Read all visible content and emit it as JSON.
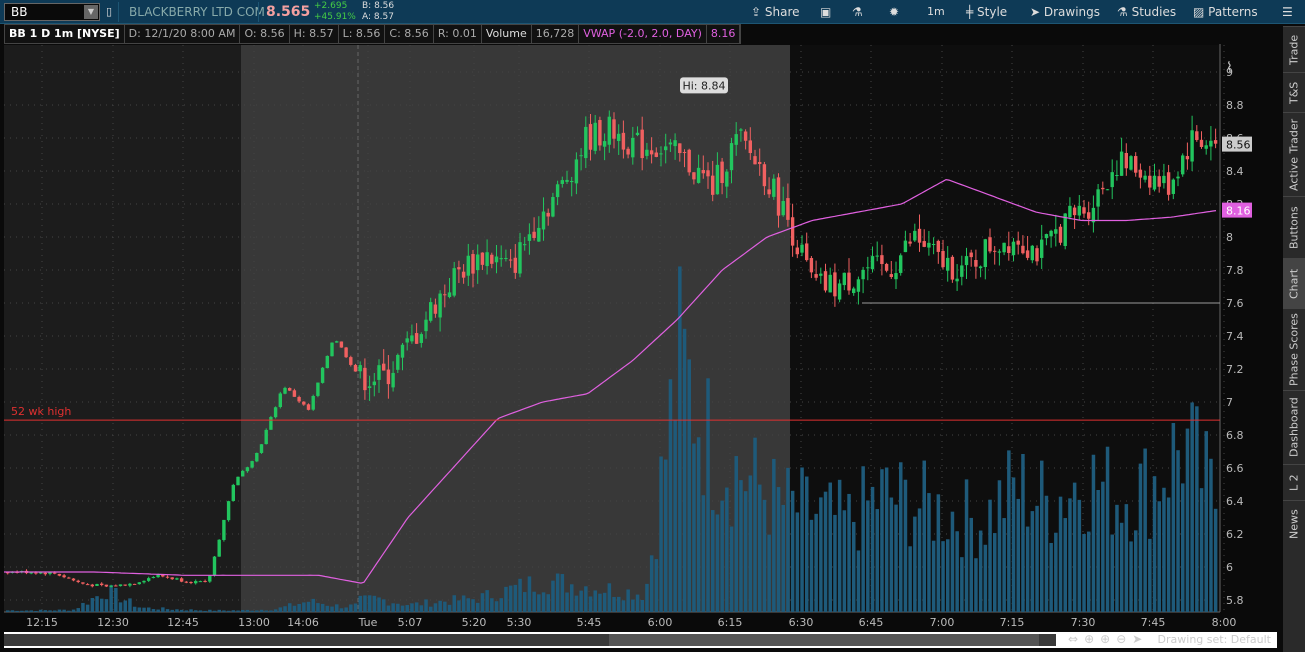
{
  "header": {
    "symbol": "BB",
    "company": "BLACKBERRY LTD COM",
    "last": "8.565",
    "change": "+2.695",
    "change_pct": "+45.91%",
    "bid": "B: 8.56",
    "ask": "A: 8.57",
    "buttons": {
      "share": "Share",
      "timeframe": "1m",
      "style": "Style",
      "drawings": "Drawings",
      "studies": "Studies",
      "patterns": "Patterns"
    }
  },
  "info_bar": [
    "BB 1 D 1m [NYSE]",
    "D: 12/1/20 8:00 AM",
    "O: 8.56",
    "H: 8.57",
    "L: 8.56",
    "C: 8.56",
    "R: 0.01",
    "Volume",
    "16,728",
    "VWAP (-2.0, 2.0, DAY)",
    "8.16"
  ],
  "side_tabs": [
    "Trade",
    "T&S",
    "Active Trader",
    "Buttons",
    "Chart",
    "Phase Scores",
    "Dashboard",
    "L 2",
    "News"
  ],
  "bottom": {
    "drawing_set": "Drawing set: Default"
  },
  "colors": {
    "up": "#22c55e",
    "down": "#f06060",
    "vwap": "#e060e0",
    "volume": "#1e5a7a",
    "wkhigh": "#e03030"
  },
  "chart_data": {
    "type": "candlestick",
    "ylim": [
      5.7,
      9.1
    ],
    "y_ticks": [
      "9",
      "8.8",
      "8.6",
      "8.4",
      "8.2",
      "8",
      "7.8",
      "7.6",
      "7.4",
      "7.2",
      "7",
      "6.8",
      "6.6",
      "6.4",
      "6.2",
      "6",
      "5.8"
    ],
    "x_labels": [
      "12:15",
      "12:30",
      "12:45",
      "13:00",
      "14:06",
      "Tue",
      "5:07",
      "5:20",
      "5:30",
      "5:45",
      "6:00",
      "6:15",
      "6:30",
      "6:45",
      "7:00",
      "7:15",
      "7:30",
      "7:45",
      "8:00"
    ],
    "price_path": [
      5.97,
      5.97,
      5.96,
      5.9,
      5.88,
      5.9,
      5.95,
      5.92,
      5.9,
      6.5,
      6.7,
      7.1,
      6.95,
      7.4,
      7.15,
      7.15,
      7.35,
      7.6,
      7.8,
      7.9,
      7.8,
      8.1,
      8.3,
      8.6,
      8.65,
      8.55,
      8.55,
      8.45,
      8.3,
      8.6,
      8.4,
      8.1,
      7.7,
      7.7,
      7.8,
      7.8,
      8.0,
      7.85,
      7.8,
      7.95,
      8.0,
      7.9,
      8.1,
      8.2,
      8.45,
      8.4,
      8.3,
      8.6,
      8.56
    ],
    "vwap_path": [
      5.97,
      5.97,
      5.97,
      5.96,
      5.95,
      5.95,
      5.95,
      5.95,
      5.9,
      6.3,
      6.6,
      6.9,
      7.0,
      7.05,
      7.25,
      7.5,
      7.8,
      8.0,
      8.1,
      8.15,
      8.2,
      8.35,
      8.25,
      8.15,
      8.1,
      8.1,
      8.12,
      8.16
    ],
    "volume_path": [
      3,
      3,
      4,
      40,
      8,
      5,
      3,
      3,
      5,
      20,
      10,
      15,
      8,
      12,
      15,
      25,
      35,
      30,
      25,
      20,
      280,
      180,
      150,
      120,
      110,
      100,
      130,
      120,
      110,
      100,
      140,
      120,
      150,
      130,
      140,
      190,
      120
    ],
    "annotations": {
      "high": "Hi: 8.84",
      "high_value": 8.84,
      "wk_high_label": "52 wk high",
      "wk_high_value": 6.89,
      "support_value": 7.6,
      "last_price": "8.56",
      "vwap_value": "8.16"
    }
  }
}
